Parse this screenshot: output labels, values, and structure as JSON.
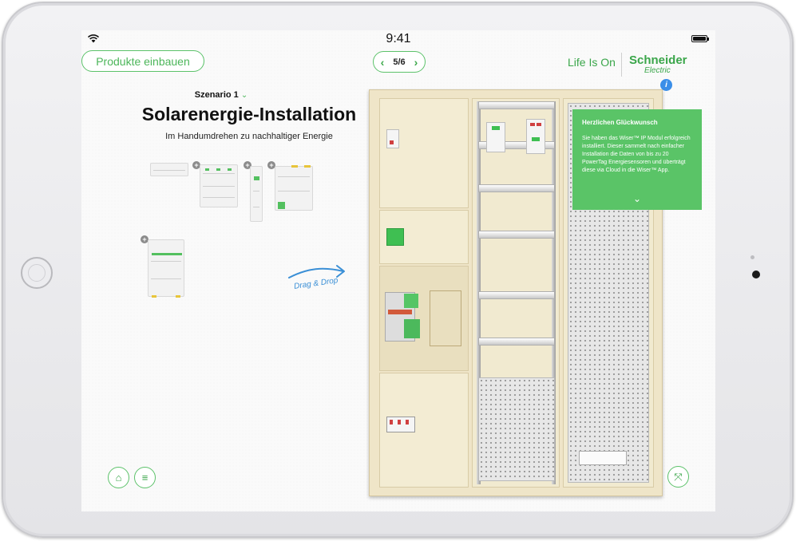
{
  "status": {
    "time": "9:41"
  },
  "nav": {
    "products_button": "Produkte einbauen",
    "pager": {
      "prev_icon": "chevron-left-icon",
      "page": "5/6",
      "next_icon": "chevron-right-icon"
    }
  },
  "brand": {
    "tagline": "Life Is On",
    "name": "Schneider",
    "sub": "Electric",
    "color": "#3aa64a"
  },
  "info_icon": "i",
  "scenario": {
    "label": "Szenario 1",
    "chevron": "⌄"
  },
  "header": {
    "title": "Solarenergie-Installation",
    "subtitle": "Im Handumdrehen zu nachhaltiger Energie"
  },
  "products": {
    "add_icon": "+"
  },
  "drag_hint": "Drag & Drop",
  "popup": {
    "heading": "Herzlichen Glückwunsch",
    "body": "Sie haben das Wiser™ IP Modul erfolgreich installiert. Dieser sammelt nach einfacher Installation die Daten von bis zu 20 PowerTag Energiesensoren und überträgt diese via Cloud in die Wiser™ App.",
    "expand_icon": "⌄",
    "color": "#5ac467"
  },
  "bottom": {
    "home_icon": "⌂",
    "menu_icon": "≡",
    "expand_icon": "⤧"
  }
}
